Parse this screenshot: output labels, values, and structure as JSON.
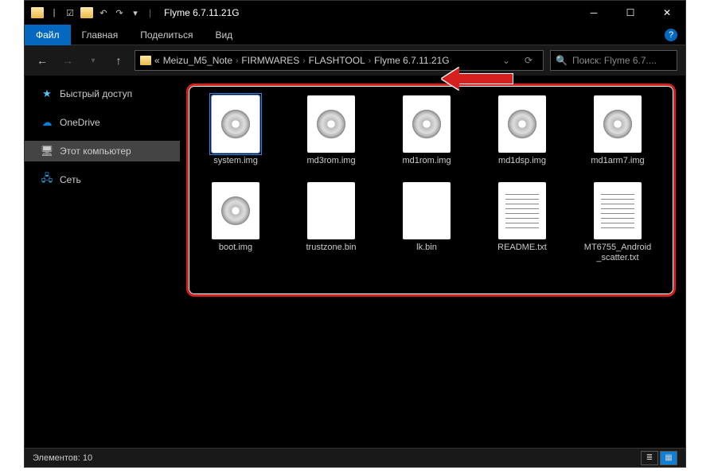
{
  "title": "Flyme 6.7.11.21G",
  "tabs": {
    "file": "Файл",
    "home": "Главная",
    "share": "Поделиться",
    "view": "Вид"
  },
  "breadcrumbs": [
    "Meizu_M5_Note",
    "FIRMWARES",
    "FLASHTOOL",
    "Flyme 6.7.11.21G"
  ],
  "search_placeholder": "Поиск: Flyme 6.7....",
  "sidebar": [
    {
      "label": "Быстрый доступ",
      "icon": "star"
    },
    {
      "label": "OneDrive",
      "icon": "cloud"
    },
    {
      "label": "Этот компьютер",
      "icon": "pc",
      "selected": true
    },
    {
      "label": "Сеть",
      "icon": "net"
    }
  ],
  "files": [
    {
      "name": "system.img",
      "type": "disc",
      "selected": true
    },
    {
      "name": "md3rom.img",
      "type": "disc"
    },
    {
      "name": "md1rom.img",
      "type": "disc"
    },
    {
      "name": "md1dsp.img",
      "type": "disc"
    },
    {
      "name": "md1arm7.img",
      "type": "disc"
    },
    {
      "name": "boot.img",
      "type": "disc"
    },
    {
      "name": "trustzone.bin",
      "type": "blank"
    },
    {
      "name": "lk.bin",
      "type": "blank"
    },
    {
      "name": "README.txt",
      "type": "text"
    },
    {
      "name": "MT6755_Android_scatter.txt",
      "type": "text"
    }
  ],
  "status": "Элементов: 10"
}
